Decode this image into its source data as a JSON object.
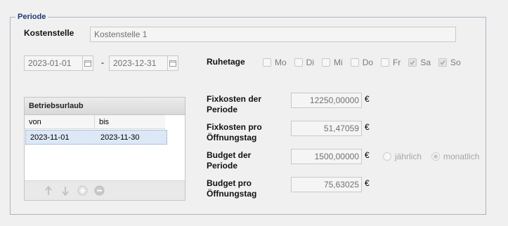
{
  "group_title": "Periode",
  "kostenstelle": {
    "label": "Kostenstelle",
    "value": "Kostenstelle 1"
  },
  "date_range": {
    "from": "2023-01-01",
    "separator": "-",
    "to": "2023-12-31"
  },
  "ruhetage": {
    "label": "Ruhetage",
    "days": [
      {
        "label": "Mo",
        "checked": false
      },
      {
        "label": "Di",
        "checked": false
      },
      {
        "label": "Mi",
        "checked": false
      },
      {
        "label": "Do",
        "checked": false
      },
      {
        "label": "Fr",
        "checked": false
      },
      {
        "label": "Sa",
        "checked": true
      },
      {
        "label": "So",
        "checked": true
      }
    ]
  },
  "betriebsurlaub": {
    "title": "Betriebsurlaub",
    "columns": [
      "von",
      "bis"
    ],
    "rows": [
      {
        "von": "2023-11-01",
        "bis": "2023-11-30"
      }
    ]
  },
  "costs": {
    "fixkosten_periode": {
      "label_line1": "Fixkosten der",
      "label_line2": "Periode",
      "value": "12250,00000",
      "unit": "€"
    },
    "fixkosten_tag": {
      "label_line1": "Fixkosten pro",
      "label_line2": "Öffnungstag",
      "value": "51,47059",
      "unit": "€"
    },
    "budget_periode": {
      "label_line1": "Budget der",
      "label_line2": "Periode",
      "value": "1500,00000",
      "unit": "€"
    },
    "budget_tag": {
      "label_line1": "Budget pro",
      "label_line2": "Öffnungstag",
      "value": "75,63025",
      "unit": "€"
    }
  },
  "budget_interval": {
    "options": [
      {
        "label": "jährlich",
        "selected": false
      },
      {
        "label": "monatlich",
        "selected": true
      }
    ]
  }
}
